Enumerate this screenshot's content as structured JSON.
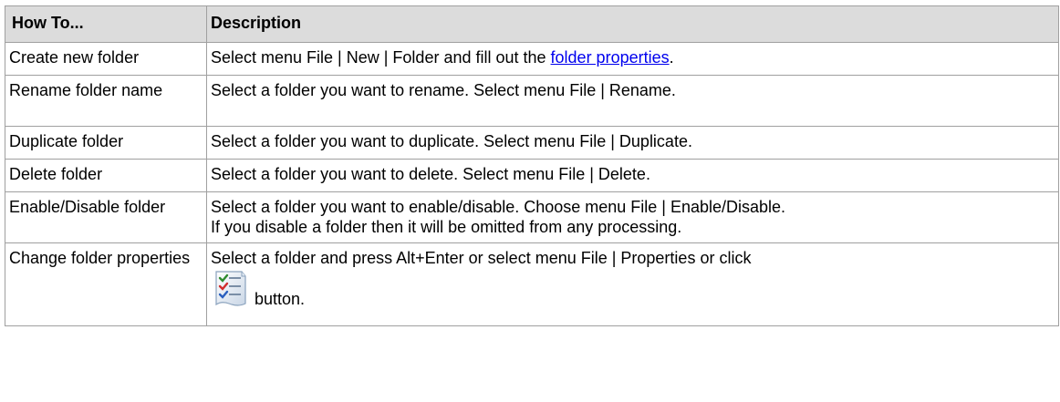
{
  "table": {
    "headers": [
      "How To...",
      "Description"
    ],
    "rows": [
      {
        "how": "Create new folder",
        "desc_before": "Select menu File | New | Folder and fill out the ",
        "link": "folder properties",
        "desc_after": "."
      },
      {
        "how": "Rename folder name",
        "desc": "Select a folder you want to rename. Select menu File | Rename."
      },
      {
        "how": "Duplicate folder",
        "desc": "Select a folder you want to duplicate. Select menu File | Duplicate."
      },
      {
        "how": "Delete folder",
        "desc": "Select a folder you want to delete. Select menu File | Delete."
      },
      {
        "how": "Enable/Disable folder",
        "desc_line1": "Select a folder you want to enable/disable. Choose menu File | Enable/Disable.",
        "desc_line2": "If you disable a folder then it will be omitted from any processing."
      },
      {
        "how": "Change folder properties",
        "desc_line1": "Select a folder and press Alt+Enter or select menu File | Properties or click",
        "icon": "properties-checklist-icon",
        "desc_line2": "button."
      }
    ]
  },
  "colors": {
    "header_bg": "#dcdcdc",
    "border": "#a0a0a0",
    "link": "#0000ee"
  }
}
